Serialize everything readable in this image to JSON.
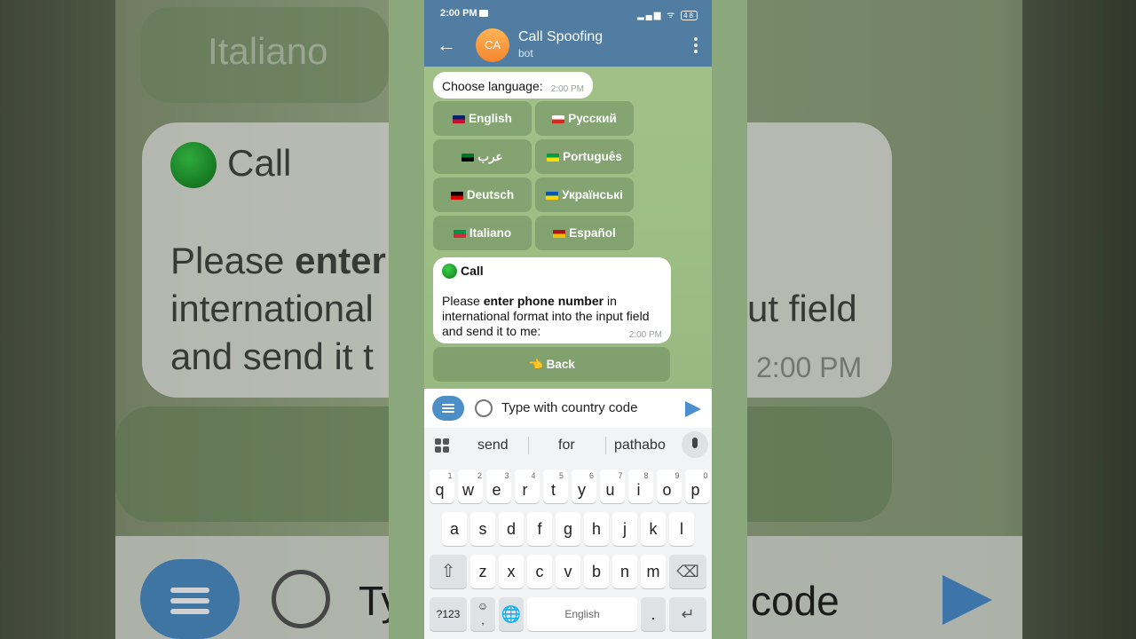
{
  "status": {
    "time": "2:00 PM",
    "battery": "48"
  },
  "header": {
    "avatar_initials": "CA",
    "title": "Call Spoofing",
    "subtitle": "bot"
  },
  "lang_message": {
    "text": "Choose language:",
    "time": "2:00 PM"
  },
  "language_buttons": [
    {
      "label": "English",
      "flag_colors": [
        "#012169",
        "#c8102e"
      ]
    },
    {
      "label": "Русский",
      "flag_colors": [
        "#ffffff",
        "#d52b1e"
      ]
    },
    {
      "label": "عرب",
      "flag_colors": [
        "#00732f",
        "#000000"
      ]
    },
    {
      "label": "Português",
      "flag_colors": [
        "#009b3a",
        "#fedf00"
      ]
    },
    {
      "label": "Deutsch",
      "flag_colors": [
        "#000000",
        "#dd0000"
      ]
    },
    {
      "label": "Українські",
      "flag_colors": [
        "#0057b7",
        "#ffd700"
      ]
    },
    {
      "label": "Italiano",
      "flag_colors": [
        "#009246",
        "#ce2b37"
      ]
    },
    {
      "label": "Español",
      "flag_colors": [
        "#aa151b",
        "#f1bf00"
      ]
    }
  ],
  "call_message": {
    "heading": "Call",
    "body_prefix": "Please ",
    "body_bold": "enter phone number",
    "body_suffix": " in international format into the input field and send it to me:",
    "time": "2:00 PM"
  },
  "back_button": {
    "label": "👈 Back"
  },
  "input": {
    "placeholder": "Type with country code"
  },
  "keyboard": {
    "suggestions": [
      "send",
      "for",
      "pathabo"
    ],
    "row1": [
      [
        "q",
        "1"
      ],
      [
        "w",
        "2"
      ],
      [
        "e",
        "3"
      ],
      [
        "r",
        "4"
      ],
      [
        "t",
        "5"
      ],
      [
        "y",
        "6"
      ],
      [
        "u",
        "7"
      ],
      [
        "i",
        "8"
      ],
      [
        "o",
        "9"
      ],
      [
        "p",
        "0"
      ]
    ],
    "row2": [
      "a",
      "s",
      "d",
      "f",
      "g",
      "h",
      "j",
      "k",
      "l"
    ],
    "row3": [
      "z",
      "x",
      "c",
      "v",
      "b",
      "n",
      "m"
    ],
    "symbols_label": "?123",
    "space_label": "English",
    "period_label": ".",
    "comma_label": ","
  },
  "background_zoom": {
    "lang_text": "Italiano",
    "call_heading": "Call",
    "line1_a": "Please ",
    "line1_b": "enter",
    "line2": "international",
    "line2_right": "ut field",
    "line3": "and send it t",
    "time": "2:00 PM",
    "input_left": "Ty",
    "input_right": "code"
  },
  "colors": {
    "header": "#527da3",
    "accent": "#4b8fd0",
    "chat_bg": "#9cbd84"
  }
}
